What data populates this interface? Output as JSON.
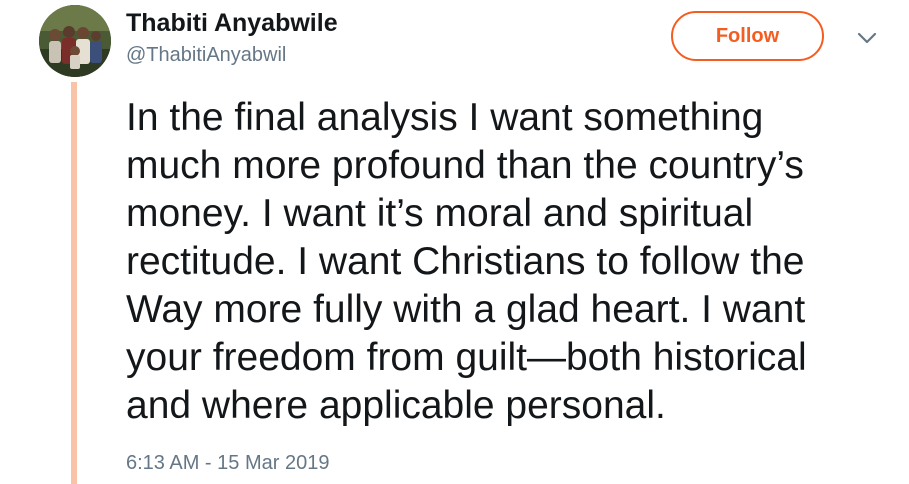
{
  "author": {
    "display_name": "Thabiti Anyabwile",
    "handle": "@ThabitiAnyabwil"
  },
  "follow_label": "Follow",
  "tweet": {
    "lines": [
      "In the final analysis I want something",
      "much more profound than the country’s",
      "money. I want it’s moral and spiritual",
      "rectitude. I want Christians to follow the",
      "Way more fully with a glad heart. I want",
      "your freedom from guilt—both historical",
      "and where applicable personal."
    ],
    "timestamp": "6:13 AM - 15 Mar 2019"
  },
  "icons": {
    "avatar": "profile-photo",
    "menu": "chevron-down-icon"
  },
  "colors": {
    "accent": "#f45d22",
    "thread_line": "#f9c3a7",
    "secondary_text": "#657786",
    "primary_text": "#14171a"
  }
}
